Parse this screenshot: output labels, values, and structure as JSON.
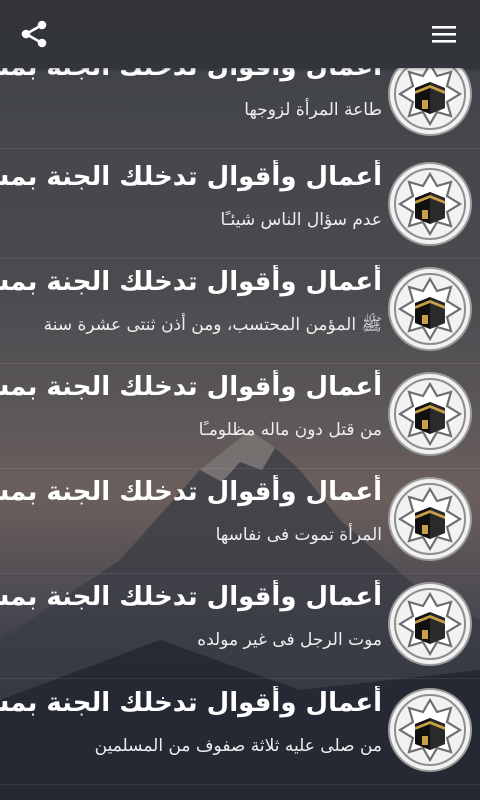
{
  "toolbar": {
    "share_icon": "share-icon",
    "menu_icon": "hamburger-menu-icon"
  },
  "items": [
    {
      "title": "أعمال وأقوال تدخلك الجنة بمشيئة",
      "subtitle": "طاعة المرأة لزوجها"
    },
    {
      "title": "أعمال وأقوال تدخلك الجنة بمشيئة",
      "subtitle": "عدم سؤال الناس شيئـًا"
    },
    {
      "title": "أعمال وأقوال تدخلك الجنة بمشيئة",
      "subtitle": "ﷺ المؤمن المحتسب، ومن أذن ثنتى عشرة سنة"
    },
    {
      "title": "أعمال وأقوال تدخلك الجنة بمشيئة",
      "subtitle": "من قتل دون ماله مظلومـًا"
    },
    {
      "title": "أعمال وأقوال تدخلك الجنة بمشيئة",
      "subtitle": "المرأة تموت فى نفاسها"
    },
    {
      "title": "أعمال وأقوال تدخلك الجنة بمشيئة",
      "subtitle": "موت الرجل فى غير مولده"
    },
    {
      "title": "أعمال وأقوال تدخلك الجنة بمشيئة",
      "subtitle": "من صلى عليه ثلاثة صفوف من المسلمين"
    }
  ],
  "colors": {
    "appbar": "#303237",
    "text": "#ffffff",
    "star_fill": "#ececec",
    "star_ring": "#b8b8b8",
    "kaaba": "#1a1a1a",
    "kaaba_band": "#c9a046"
  }
}
